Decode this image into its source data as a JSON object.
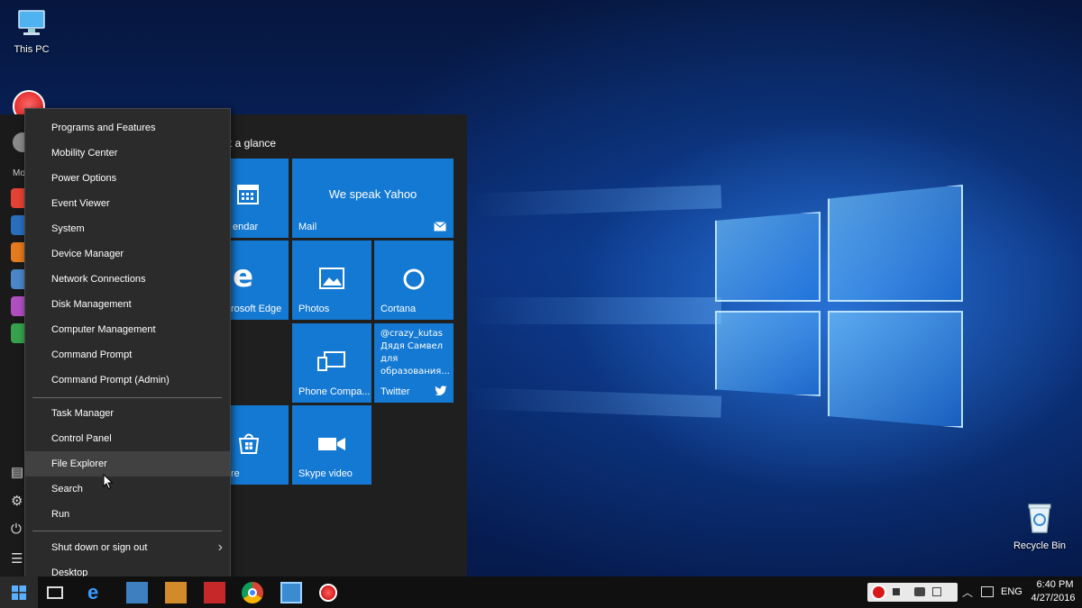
{
  "desktop": {
    "icons": [
      {
        "label": "This PC",
        "icon": "computer-icon"
      },
      {
        "label": "Recycle Bin",
        "icon": "recycle-bin-icon"
      }
    ]
  },
  "start_menu": {
    "group_title": "t a glance",
    "left_strip_label": "Mo",
    "tiles": [
      {
        "label": "endar",
        "icon": "calendar-icon"
      },
      {
        "label": "Mail",
        "headline": "We speak Yahoo",
        "icon": "mail-icon"
      },
      {
        "label": "rosoft Edge",
        "icon": "edge-icon"
      },
      {
        "label": "Photos",
        "icon": "photos-icon"
      },
      {
        "label": "Cortana",
        "icon": "cortana-icon"
      },
      {
        "label": "Phone Compa...",
        "icon": "phone-companion-icon"
      },
      {
        "label": "Twitter",
        "handle": "@crazy_kutas",
        "tweet_line1": "Дядя Самвел",
        "tweet_line2": "для",
        "tweet_line3": "образования...",
        "icon": "twitter-icon"
      },
      {
        "label": "re",
        "icon": "store-icon"
      },
      {
        "label": "Skype video",
        "icon": "skype-video-icon"
      }
    ]
  },
  "context_menu": {
    "items": [
      "Programs and Features",
      "Mobility Center",
      "Power Options",
      "Event Viewer",
      "System",
      "Device Manager",
      "Network Connections",
      "Disk Management",
      "Computer Management",
      "Command Prompt",
      "Command Prompt (Admin)",
      "Task Manager",
      "Control Panel",
      "File Explorer",
      "Search",
      "Run",
      "Shut down or sign out",
      "Desktop"
    ],
    "hovered_item": "File Explorer",
    "submenu_arrow": "›"
  },
  "taskbar": {
    "language": "ENG",
    "time": "6:40 PM",
    "date": "4/27/2016"
  },
  "colors": {
    "tile_blue": "#1479d2",
    "menu_bg": "#2b2b2b",
    "taskbar_bg": "#101010"
  }
}
